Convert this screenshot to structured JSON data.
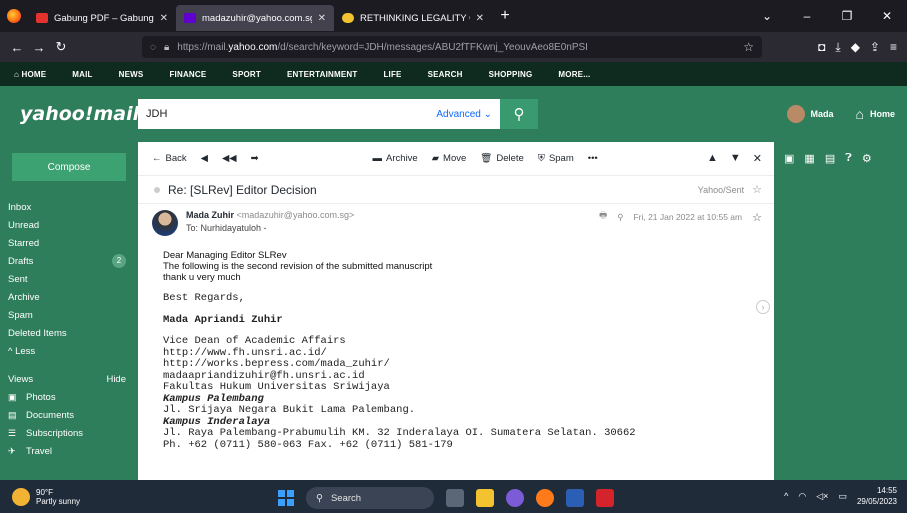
{
  "browser": {
    "tabs": [
      {
        "label": "Gabung PDF – Gabungkan PDF",
        "fav_color": "#e5322d",
        "active": false
      },
      {
        "label": "madazuhir@yahoo.com.sg - Yahoo",
        "fav_color": "#6001d2",
        "active": true
      },
      {
        "label": "RETHINKING LEGALITY OF STATE",
        "fav_color": "#f2c230",
        "active": false
      }
    ],
    "url_prefix": "https://mail.",
    "url_host": "yahoo.com",
    "url_rest": "/d/search/keyword=JDH/messages/ABU2fTFKwnj_YeouvAeo8E0nPSI"
  },
  "ynav": [
    "HOME",
    "MAIL",
    "NEWS",
    "FINANCE",
    "SPORT",
    "ENTERTAINMENT",
    "LIFE",
    "SEARCH",
    "SHOPPING",
    "MORE..."
  ],
  "header": {
    "logo": "yahoo!mail",
    "search_value": "JDH",
    "advanced": "Advanced",
    "user": "Mada",
    "home": "Home"
  },
  "sidebar": {
    "compose": "Compose",
    "folders": [
      {
        "label": "Inbox"
      },
      {
        "label": "Unread"
      },
      {
        "label": "Starred"
      },
      {
        "label": "Drafts",
        "count": "2"
      },
      {
        "label": "Sent"
      },
      {
        "label": "Archive"
      },
      {
        "label": "Spam"
      },
      {
        "label": "Deleted Items"
      },
      {
        "label": "^ Less"
      }
    ],
    "views_label": "Views",
    "views_hide": "Hide",
    "views": [
      {
        "label": "Photos",
        "icon": "photos-icon"
      },
      {
        "label": "Documents",
        "icon": "documents-icon"
      },
      {
        "label": "Subscriptions",
        "icon": "subscriptions-icon"
      },
      {
        "label": "Travel",
        "icon": "travel-icon"
      }
    ]
  },
  "toolbar": {
    "back": "Back",
    "archive": "Archive",
    "move": "Move",
    "delete": "Delete",
    "spam": "Spam",
    "more": "•••"
  },
  "message": {
    "subject": "Re: [SLRev] Editor Decision",
    "folder": "Yahoo/Sent",
    "from_name": "Mada Zuhir",
    "from_email": "<madazuhir@yahoo.com.sg>",
    "to": "To: Nurhidayatuloh -",
    "date": "Fri, 21 Jan 2022 at 10:55 am",
    "body_sans": [
      "Dear Managing Editor SLRev",
      "The following is the second revision of the submitted manuscript",
      "thank u very much"
    ],
    "regards": "Best Regards,",
    "signature_name": "Mada Apriandi Zuhir",
    "sig_lines": [
      {
        "text": "Vice Dean of Academic Affairs",
        "style": ""
      },
      {
        "text": "http://www.fh.unsri.ac.id/",
        "style": ""
      },
      {
        "text": "http://works.bepress.com/mada_zuhir/",
        "style": ""
      },
      {
        "text": "madaapriandizuhir@fh.unsri.ac.id",
        "style": ""
      },
      {
        "text": "Fakultas Hukum Universitas Sriwijaya",
        "style": ""
      },
      {
        "text": "Kampus Palembang",
        "style": "bi"
      },
      {
        "text": "Jl. Srijaya Negara Bukit Lama Palembang.",
        "style": ""
      },
      {
        "text": "Kampus Inderalaya",
        "style": "bi"
      },
      {
        "text": "Jl. Raya Palembang-Prabumulih KM. 32 Inderalaya OI. Sumatera Selatan. 30662",
        "style": ""
      },
      {
        "text": "Ph. +62 (0711) 580-063 Fax. +62 (0711) 581-179",
        "style": ""
      }
    ]
  },
  "taskbar": {
    "temp": "90°F",
    "weather": "Partly sunny",
    "search": "Search",
    "time": "14:55",
    "date": "29/05/2023"
  }
}
